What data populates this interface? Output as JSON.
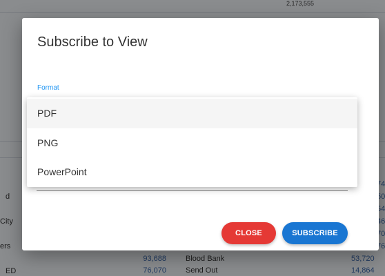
{
  "background": {
    "top_text": "2,173,555",
    "left_labels": [
      "d",
      "City",
      "ers",
      "ED"
    ],
    "mid_values": [
      "93,688",
      "76,070"
    ],
    "mid_labels": [
      "Blood Bank",
      "Send Out"
    ],
    "right_values": [
      "74",
      "50",
      "54",
      "46",
      "70",
      "76",
      "53,720",
      "14,864"
    ]
  },
  "dialog": {
    "title": "Subscribe to View",
    "format_label": "Format",
    "options": [
      {
        "label": "PDF",
        "selected": true
      },
      {
        "label": "PNG",
        "selected": false
      },
      {
        "label": "PowerPoint",
        "selected": false
      }
    ],
    "close_label": "CLOSE",
    "subscribe_label": "SUBSCRIBE"
  },
  "colors": {
    "accent": "#2196f3",
    "close": "#e53935",
    "subscribe": "#1976d2"
  }
}
